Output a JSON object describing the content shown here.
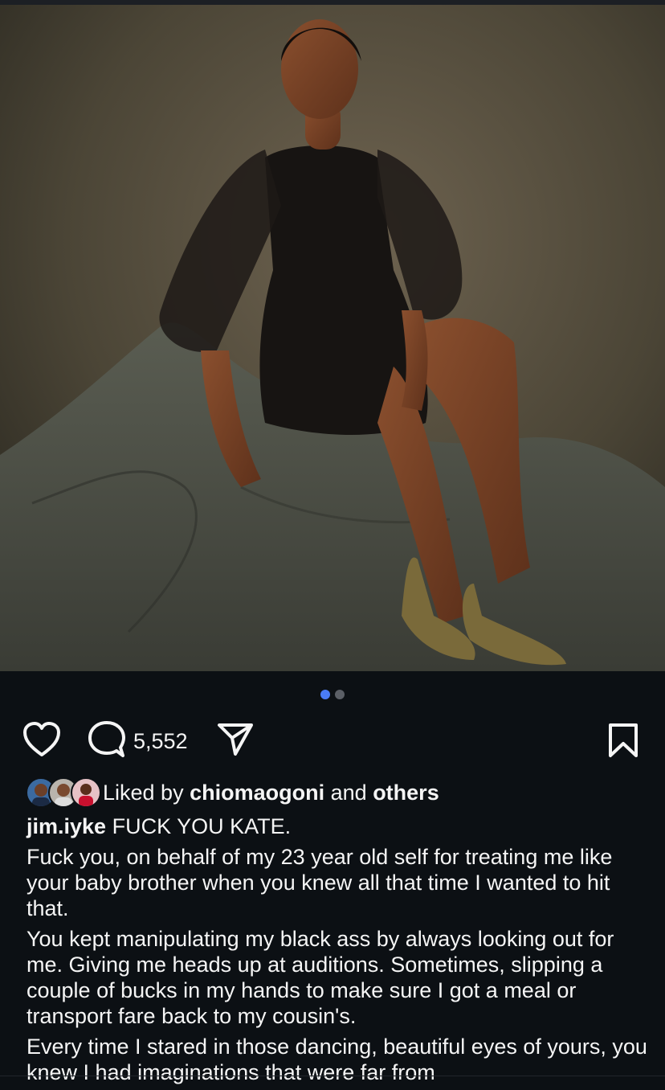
{
  "post": {
    "image_alt": "Woman in sheer black dress seated on draped grey fabric",
    "carousel": {
      "count": 2,
      "active": 0
    }
  },
  "actions": {
    "like_icon": "heart-icon",
    "comment_icon": "comment-icon",
    "comment_count": "5,552",
    "share_icon": "send-icon",
    "save_icon": "bookmark-icon"
  },
  "likes": {
    "prefix": "Liked by",
    "user": "chiomaogoni",
    "joiner": "and",
    "others": "others"
  },
  "caption": {
    "username": "jim.iyke",
    "headline": "FUCK YOU KATE.",
    "paragraphs": [
      "Fuck you, on behalf of my 23 year old self for treating me like your baby brother when you knew all that time I wanted to hit that.",
      "You kept manipulating my black ass by always looking out for me. Giving me heads up at auditions. Sometimes, slipping a couple of bucks in my hands to make sure I got a meal or transport fare back to my cousin's.",
      "Every time I stared in those dancing, beautiful eyes of yours, you knew I had imaginations that were far from"
    ]
  },
  "colors": {
    "background": "#0c1014",
    "text": "#f5f5f5",
    "accent_dot": "#4a7cf5"
  }
}
